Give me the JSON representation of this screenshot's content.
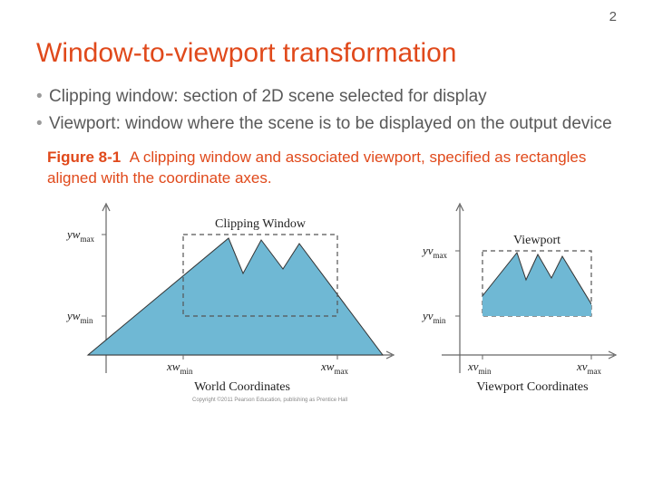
{
  "page_number": "2",
  "title": "Window-to-viewport transformation",
  "bullets": [
    "Clipping window: section of 2D scene selected for display",
    "Viewport: window where the scene is to be displayed on the output device"
  ],
  "figure": {
    "num": "Figure 8-1",
    "text": "A clipping window and associated viewport, specified as rectangles aligned with the coordinate axes.",
    "left": {
      "box_label": "Clipping Window",
      "sublabel": "World Coordinates",
      "ywmax": "yw",
      "ywmax_sub": "max",
      "ywmin": "yw",
      "ywmin_sub": "min",
      "xwmin": "xw",
      "xwmin_sub": "min",
      "xwmax": "xw",
      "xwmax_sub": "max"
    },
    "right": {
      "box_label": "Viewport",
      "sublabel": "Viewport Coordinates",
      "yvmax": "yv",
      "yvmax_sub": "max",
      "yvmin": "yv",
      "yvmin_sub": "min",
      "xvmin": "xv",
      "xvmin_sub": "min",
      "xvmax": "xv",
      "xvmax_sub": "max"
    },
    "copyright": "Copyright ©2011 Pearson Education, publishing as Prentice Hall"
  }
}
